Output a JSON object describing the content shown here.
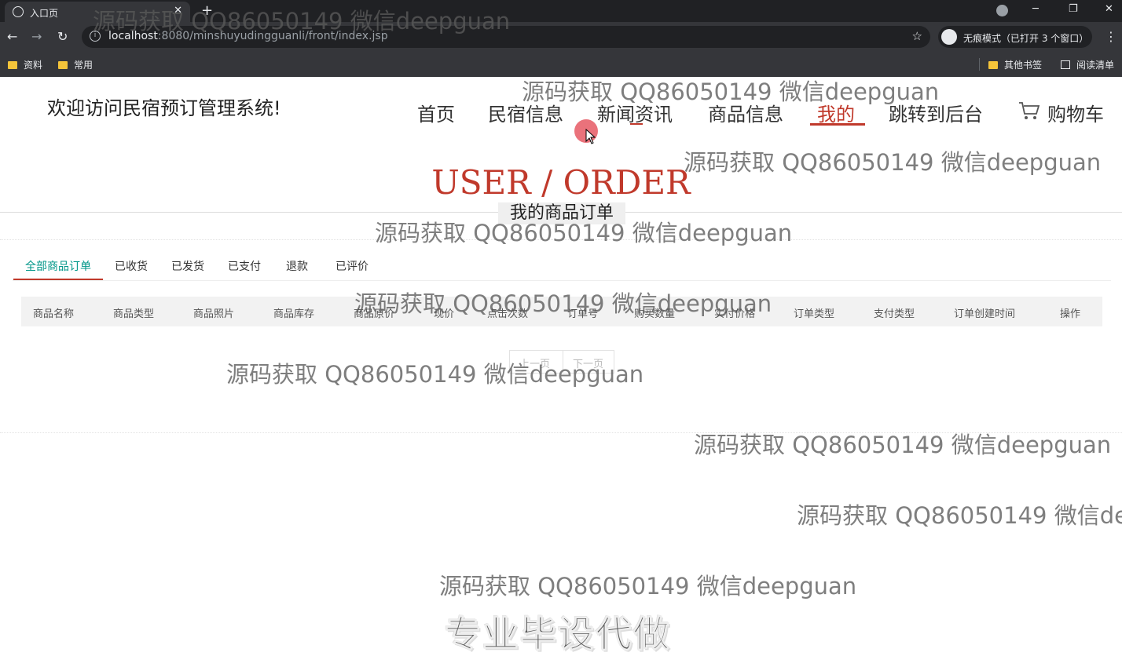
{
  "browser": {
    "tab_title": "入口页",
    "tab_close": "✕",
    "new_tab": "+",
    "url_host": "localhost",
    "url_path": ":8080/minshuyudingguanli/front/index.jsp",
    "incognito_label": "无痕模式（已打开 3 个窗口）",
    "bookmarks": [
      "资料",
      "常用"
    ],
    "other_bookmarks": "其他书签",
    "reading_list": "阅读清单"
  },
  "site": {
    "title": "欢迎访问民宿预订管理系统!",
    "nav": [
      "首页",
      "民宿信息",
      "新闻资讯",
      "商品信息",
      "我的",
      "跳转到后台"
    ],
    "cart_label": "购物车"
  },
  "main": {
    "heading": "USER / ORDER",
    "subtitle": "我的商品订单",
    "order_tabs": [
      "全部商品订单",
      "已收货",
      "已发货",
      "已支付",
      "退款",
      "已评价"
    ],
    "columns": [
      "商品名称",
      "商品类型",
      "商品照片",
      "商品库存",
      "商品原价",
      "现价",
      "点击次数",
      "订单号",
      "购买数量",
      "实付价格",
      "订单类型",
      "支付类型",
      "订单创建时间",
      "操作"
    ],
    "pager": {
      "prev": "上一页",
      "next": "下一页"
    }
  },
  "watermarks": {
    "text": "源码获取 QQ86050149 微信deepguan",
    "cut_text": "源码获取 QQ86050149 微信de",
    "slogan": "专业毕设代做"
  },
  "colors": {
    "accent": "#c0392b",
    "tab_active": "#009688"
  }
}
